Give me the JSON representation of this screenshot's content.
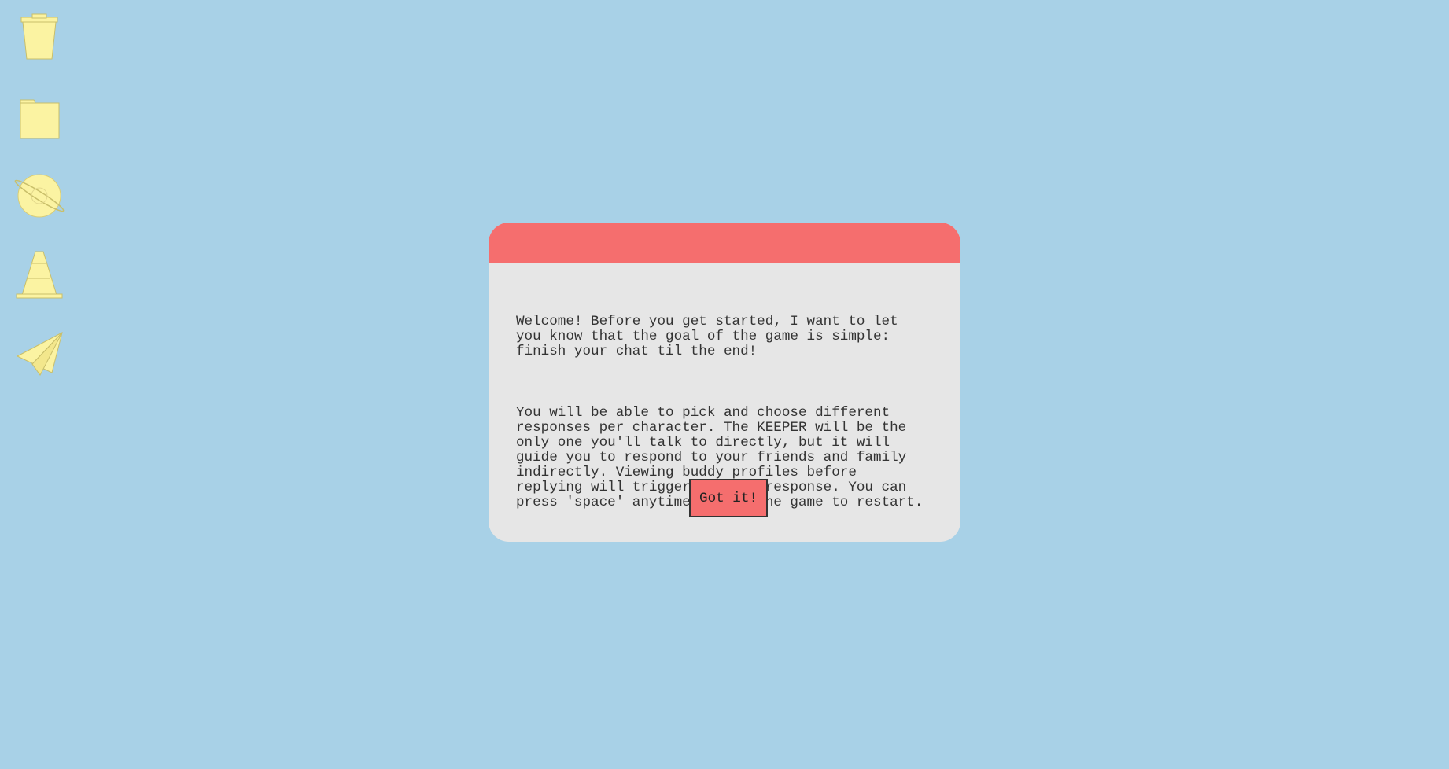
{
  "desktop": {
    "background": "#a8d1e7",
    "icons": [
      {
        "name": "trash-icon"
      },
      {
        "name": "folder-icon"
      },
      {
        "name": "planet-icon"
      },
      {
        "name": "traffic-cone-icon"
      },
      {
        "name": "paper-plane-icon"
      }
    ],
    "icon_color": "#fbf3a2"
  },
  "dialog": {
    "titlebar_color": "#f56e6e",
    "body_color": "#e6e6e6",
    "paragraph_1": "Welcome! Before you get started, I want to let\nyou know that the goal of the game is simple:\nfinish your chat til the end!",
    "paragraph_2": "You will be able to pick and choose different\nresponses per character. The KEEPER will be the\nonly one you'll talk to directly, but it will\nguide you to respond to your friends and family\nindirectly. Viewing buddy profiles before\nreplying will trigger a third response. You can\npress 'space' anytime during the game to restart.",
    "button_label": "Got it!"
  }
}
